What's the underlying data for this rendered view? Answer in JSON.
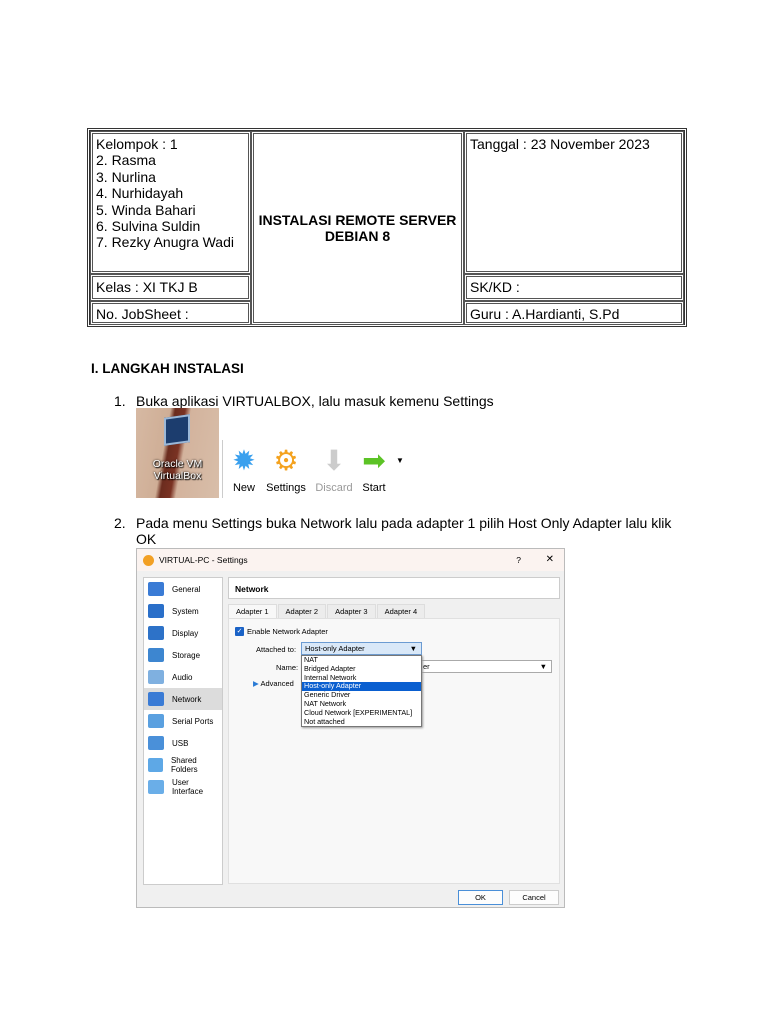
{
  "header_table": {
    "group_lines": [
      "Kelompok : 1",
      "2. Rasma",
      "3. Nurlina",
      "4. Nurhidayah",
      "5. Winda Bahari",
      "6. Sulvina Suldin",
      "7. Rezky Anugra Wadi"
    ],
    "title_line1": "INSTALASI REMOTE SERVER",
    "title_line2": "DEBIAN 8",
    "date": "Tanggal : 23 November  2023",
    "class": "Kelas : XI TKJ B",
    "sk_kd": "SK/KD :",
    "jobsheet": "No. JobSheet :",
    "teacher": "Guru : A.Hardianti, S.Pd"
  },
  "section_heading": "I. LANGKAH INSTALASI",
  "steps": [
    {
      "number": "1.",
      "text": "Buka aplikasi VIRTUALBOX, lalu masuk kemenu Settings"
    },
    {
      "number": "2.",
      "text_line1": "Pada menu Settings buka Network lalu pada adapter 1 pilih Host Only Adapter lalu klik",
      "text_line2": "OK"
    }
  ],
  "desktop_icon": {
    "label_line1": "Oracle VM",
    "label_line2": "VirtualBox"
  },
  "toolbar": {
    "new": "New",
    "settings": "Settings",
    "discard": "Discard",
    "start": "Start"
  },
  "dialog": {
    "title": "VIRTUAL-PC - Settings",
    "help": "?",
    "close": "✕",
    "sidebar": [
      {
        "label": "General",
        "color": "#3a7bd5"
      },
      {
        "label": "System",
        "color": "#2a6fc9"
      },
      {
        "label": "Display",
        "color": "#2d72c8"
      },
      {
        "label": "Storage",
        "color": "#3d86d0"
      },
      {
        "label": "Audio",
        "color": "#7fb0e0"
      },
      {
        "label": "Network",
        "color": "#3a7bd5"
      },
      {
        "label": "Serial Ports",
        "color": "#5aa0e0"
      },
      {
        "label": "USB",
        "color": "#4a90d9"
      },
      {
        "label": "Shared Folders",
        "color": "#5ea8e6"
      },
      {
        "label": "User Interface",
        "color": "#6aaee8"
      }
    ],
    "selected": "Network",
    "section_title": "Network",
    "tabs": [
      "Adapter 1",
      "Adapter 2",
      "Adapter 3",
      "Adapter 4"
    ],
    "enable_label": "Enable Network Adapter",
    "attached_label": "Attached to:",
    "attached_value": "Host-only Adapter",
    "name_label": "Name:",
    "name_value_tail": "er",
    "advanced_label": "Advanced",
    "options": [
      "NAT",
      "Bridged Adapter",
      "Internal Network",
      "Host-only Adapter",
      "Generic Driver",
      "NAT Network",
      "Cloud Network [EXPERIMENTAL]",
      "Not attached"
    ],
    "ok": "OK",
    "cancel": "Cancel"
  }
}
